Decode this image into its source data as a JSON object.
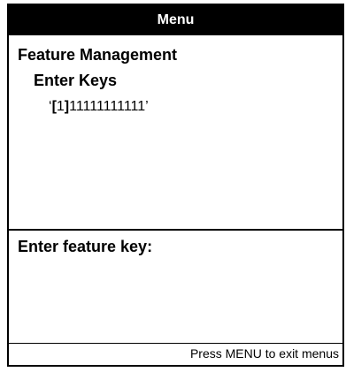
{
  "title_bar": {
    "title": "Menu"
  },
  "menu": {
    "heading": "Feature Management",
    "subheading": "Enter Keys",
    "key_entry": {
      "open_quote": "‘",
      "open_bracket": "[",
      "cursor_char": "1",
      "close_bracket": "]",
      "rest": "11111111111",
      "close_quote": "’"
    }
  },
  "prompt": {
    "label": "Enter feature key:"
  },
  "footer": {
    "hint": "Press MENU to exit menus"
  },
  "colors": {
    "background": "#ffffff",
    "foreground": "#000000",
    "title_bar_bg": "#000000",
    "title_bar_fg": "#ffffff"
  }
}
